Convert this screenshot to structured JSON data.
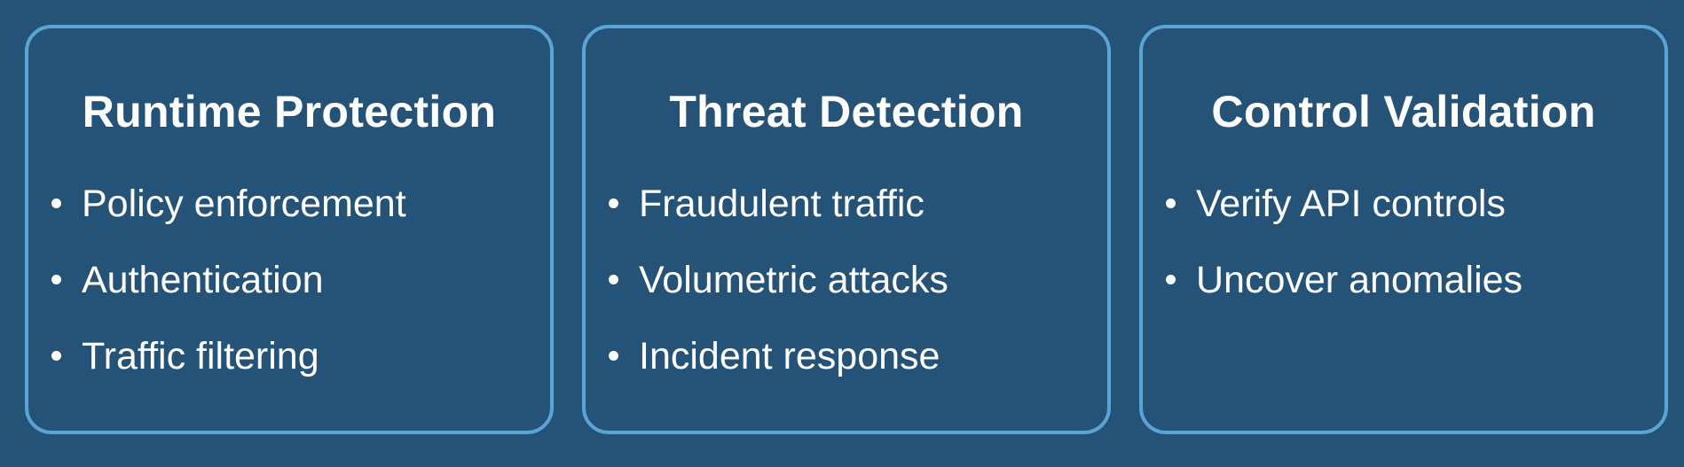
{
  "colors": {
    "background": "#255378",
    "card_border": "#5aa5d6",
    "text": "#ffffff"
  },
  "cards": [
    {
      "title": "Runtime Protection",
      "items": [
        "Policy enforcement",
        "Authentication",
        "Traffic filtering"
      ]
    },
    {
      "title": "Threat Detection",
      "items": [
        "Fraudulent traffic",
        "Volumetric attacks",
        "Incident response"
      ]
    },
    {
      "title": "Control Validation",
      "items": [
        "Verify API controls",
        "Uncover anomalies"
      ]
    }
  ]
}
